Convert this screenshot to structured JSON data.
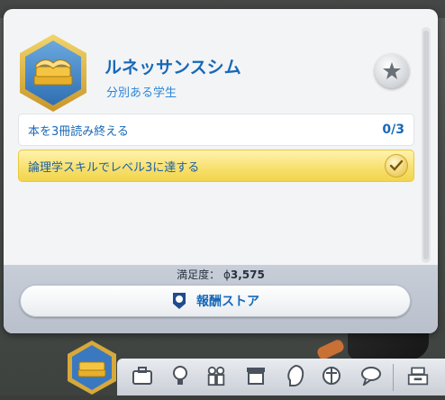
{
  "aspiration": {
    "title": "ルネッサンスシム",
    "milestone": "分別ある学生",
    "icon": "books-icon",
    "medal_icon": "star-medal-icon"
  },
  "tasks": [
    {
      "label": "本を3冊読み終える",
      "progress": "0/3",
      "complete": false
    },
    {
      "label": "論理学スキルでレベル3に達する",
      "progress": "",
      "complete": true
    }
  ],
  "footer": {
    "satisfaction_label": "満足度：",
    "satisfaction_value": "3,575",
    "satisfaction_icon": "simoleon-satisfaction-icon",
    "reward_store_label": "報酬ストア",
    "reward_store_icon": "reward-store-icon"
  },
  "dock": {
    "items": [
      "aspiration-icon",
      "career-icon",
      "skills-icon",
      "relationships-icon",
      "inventory-icon",
      "sim-profile-icon",
      "motives-icon",
      "social-icon",
      "household-funds-icon"
    ]
  },
  "colors": {
    "accent": "#1769b8",
    "gold": "#f7df6a"
  }
}
